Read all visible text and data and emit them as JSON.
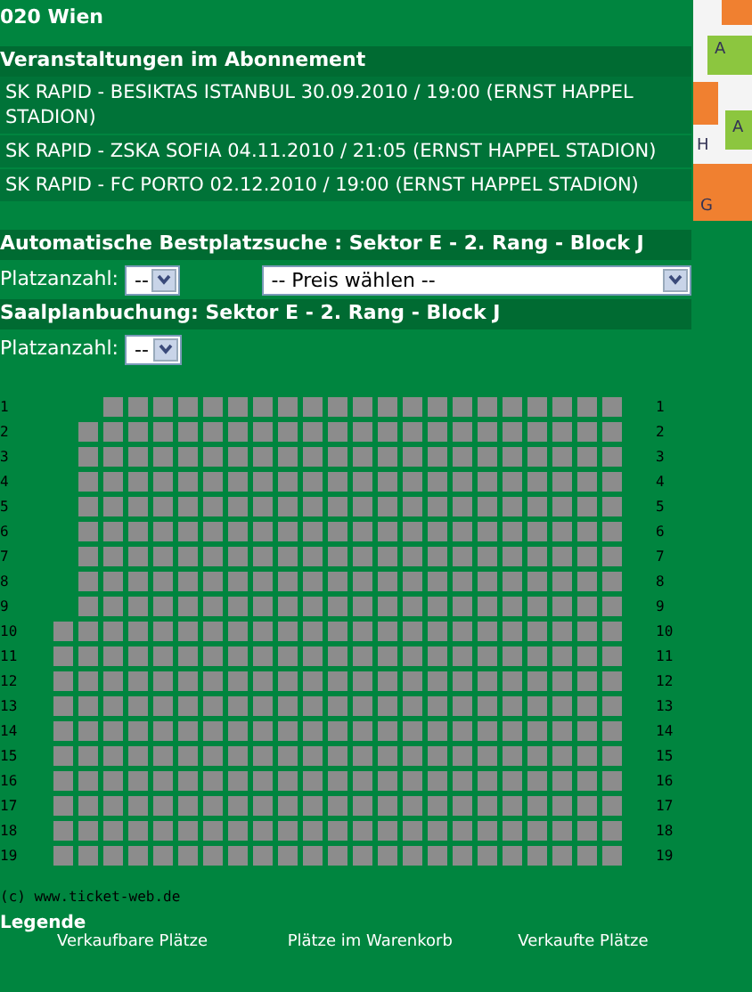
{
  "address": "020 Wien",
  "map": {
    "labels": [
      "A",
      "A",
      "H",
      "G"
    ]
  },
  "subscription": {
    "title": "Veranstaltungen im Abonnement",
    "events": [
      "SK RAPID - BESIKTAS ISTANBUL 30.09.2010 / 19:00 (ERNST HAPPEL STADION)",
      "SK RAPID - ZSKA SOFIA 04.11.2010 / 21:05 (ERNST HAPPEL STADION)",
      "SK RAPID - FC PORTO 02.12.2010 / 19:00 (ERNST HAPPEL STADION)"
    ]
  },
  "best_seat": {
    "title": "Automatische Bestplatzsuche : Sektor E - 2. Rang - Block J",
    "count_label": "Platzanzahl:",
    "count_value": "--",
    "price_value": "-- Preis wählen --"
  },
  "seat_plan": {
    "title": "Saalplanbuchung: Sektor E - 2. Rang - Block J",
    "count_label": "Platzanzahl:",
    "count_value": "--",
    "rows": [
      {
        "left_label": "1",
        "right_label": "1",
        "seats": [
          {
            "kind": "gap"
          },
          {
            "kind": "gap"
          },
          {
            "kind": "free"
          },
          {
            "kind": "free"
          },
          {
            "kind": "free"
          },
          {
            "kind": "free"
          },
          {
            "kind": "free"
          },
          {
            "kind": "free"
          },
          {
            "kind": "free"
          },
          {
            "kind": "free"
          },
          {
            "kind": "free"
          },
          {
            "kind": "free"
          },
          {
            "kind": "free"
          },
          {
            "kind": "free"
          },
          {
            "kind": "free"
          },
          {
            "kind": "free"
          },
          {
            "kind": "free"
          },
          {
            "kind": "free"
          },
          {
            "kind": "free"
          },
          {
            "kind": "free"
          },
          {
            "kind": "free"
          },
          {
            "kind": "free"
          },
          {
            "kind": "free"
          }
        ]
      },
      {
        "left_label": "2",
        "right_label": "2",
        "seats": [
          {
            "kind": "gap"
          },
          {
            "kind": "free"
          },
          {
            "kind": "free"
          },
          {
            "kind": "free"
          },
          {
            "kind": "free"
          },
          {
            "kind": "free"
          },
          {
            "kind": "free"
          },
          {
            "kind": "free"
          },
          {
            "kind": "free"
          },
          {
            "kind": "free"
          },
          {
            "kind": "free"
          },
          {
            "kind": "free"
          },
          {
            "kind": "free"
          },
          {
            "kind": "free"
          },
          {
            "kind": "free"
          },
          {
            "kind": "free"
          },
          {
            "kind": "free"
          },
          {
            "kind": "free"
          },
          {
            "kind": "free"
          },
          {
            "kind": "free"
          },
          {
            "kind": "free"
          },
          {
            "kind": "free"
          },
          {
            "kind": "free"
          }
        ]
      },
      {
        "left_label": "3",
        "right_label": "3",
        "seats": [
          {
            "kind": "gap"
          },
          {
            "kind": "free"
          },
          {
            "kind": "free"
          },
          {
            "kind": "free"
          },
          {
            "kind": "free"
          },
          {
            "kind": "free"
          },
          {
            "kind": "free"
          },
          {
            "kind": "free"
          },
          {
            "kind": "free"
          },
          {
            "kind": "free"
          },
          {
            "kind": "free"
          },
          {
            "kind": "free"
          },
          {
            "kind": "free"
          },
          {
            "kind": "free"
          },
          {
            "kind": "free"
          },
          {
            "kind": "free"
          },
          {
            "kind": "free"
          },
          {
            "kind": "free"
          },
          {
            "kind": "free"
          },
          {
            "kind": "free"
          },
          {
            "kind": "free"
          },
          {
            "kind": "free"
          },
          {
            "kind": "free"
          }
        ]
      },
      {
        "left_label": "4",
        "right_label": "4",
        "seats": [
          {
            "kind": "gap"
          },
          {
            "kind": "free"
          },
          {
            "kind": "free"
          },
          {
            "kind": "free"
          },
          {
            "kind": "free"
          },
          {
            "kind": "free"
          },
          {
            "kind": "free"
          },
          {
            "kind": "free"
          },
          {
            "kind": "free"
          },
          {
            "kind": "free"
          },
          {
            "kind": "free"
          },
          {
            "kind": "free"
          },
          {
            "kind": "free"
          },
          {
            "kind": "free"
          },
          {
            "kind": "free"
          },
          {
            "kind": "free"
          },
          {
            "kind": "free"
          },
          {
            "kind": "free"
          },
          {
            "kind": "free"
          },
          {
            "kind": "free"
          },
          {
            "kind": "free"
          },
          {
            "kind": "free"
          },
          {
            "kind": "free"
          }
        ]
      },
      {
        "left_label": "5",
        "right_label": "5",
        "seats": [
          {
            "kind": "gap"
          },
          {
            "kind": "free"
          },
          {
            "kind": "free"
          },
          {
            "kind": "free"
          },
          {
            "kind": "free"
          },
          {
            "kind": "free"
          },
          {
            "kind": "free"
          },
          {
            "kind": "free"
          },
          {
            "kind": "free"
          },
          {
            "kind": "free"
          },
          {
            "kind": "free"
          },
          {
            "kind": "free"
          },
          {
            "kind": "free"
          },
          {
            "kind": "free"
          },
          {
            "kind": "free"
          },
          {
            "kind": "free"
          },
          {
            "kind": "free"
          },
          {
            "kind": "free"
          },
          {
            "kind": "free"
          },
          {
            "kind": "free"
          },
          {
            "kind": "free"
          },
          {
            "kind": "free"
          },
          {
            "kind": "free"
          }
        ]
      },
      {
        "left_label": "6",
        "right_label": "6",
        "seats": [
          {
            "kind": "gap"
          },
          {
            "kind": "free"
          },
          {
            "kind": "free"
          },
          {
            "kind": "free"
          },
          {
            "kind": "free"
          },
          {
            "kind": "free"
          },
          {
            "kind": "free"
          },
          {
            "kind": "free"
          },
          {
            "kind": "free"
          },
          {
            "kind": "free"
          },
          {
            "kind": "free"
          },
          {
            "kind": "free"
          },
          {
            "kind": "free"
          },
          {
            "kind": "free"
          },
          {
            "kind": "free"
          },
          {
            "kind": "free"
          },
          {
            "kind": "free"
          },
          {
            "kind": "free"
          },
          {
            "kind": "free"
          },
          {
            "kind": "free"
          },
          {
            "kind": "free"
          },
          {
            "kind": "free"
          },
          {
            "kind": "free"
          }
        ]
      },
      {
        "left_label": "7",
        "right_label": "7",
        "seats": [
          {
            "kind": "gap"
          },
          {
            "kind": "free"
          },
          {
            "kind": "free"
          },
          {
            "kind": "free"
          },
          {
            "kind": "free"
          },
          {
            "kind": "free"
          },
          {
            "kind": "free"
          },
          {
            "kind": "free"
          },
          {
            "kind": "free"
          },
          {
            "kind": "free"
          },
          {
            "kind": "free"
          },
          {
            "kind": "free"
          },
          {
            "kind": "free"
          },
          {
            "kind": "free"
          },
          {
            "kind": "free"
          },
          {
            "kind": "free"
          },
          {
            "kind": "free"
          },
          {
            "kind": "free"
          },
          {
            "kind": "free"
          },
          {
            "kind": "free"
          },
          {
            "kind": "free"
          },
          {
            "kind": "free"
          },
          {
            "kind": "free"
          }
        ]
      },
      {
        "left_label": "8",
        "right_label": "8",
        "seats": [
          {
            "kind": "gap"
          },
          {
            "kind": "free"
          },
          {
            "kind": "free"
          },
          {
            "kind": "free"
          },
          {
            "kind": "free"
          },
          {
            "kind": "free"
          },
          {
            "kind": "free"
          },
          {
            "kind": "free"
          },
          {
            "kind": "free"
          },
          {
            "kind": "free"
          },
          {
            "kind": "free"
          },
          {
            "kind": "free"
          },
          {
            "kind": "free"
          },
          {
            "kind": "free"
          },
          {
            "kind": "free"
          },
          {
            "kind": "free"
          },
          {
            "kind": "free"
          },
          {
            "kind": "free"
          },
          {
            "kind": "free"
          },
          {
            "kind": "free"
          },
          {
            "kind": "free"
          },
          {
            "kind": "free"
          },
          {
            "kind": "free"
          }
        ]
      },
      {
        "left_label": "9",
        "right_label": "9",
        "seats": [
          {
            "kind": "gap"
          },
          {
            "kind": "free"
          },
          {
            "kind": "free"
          },
          {
            "kind": "free"
          },
          {
            "kind": "free"
          },
          {
            "kind": "free"
          },
          {
            "kind": "free"
          },
          {
            "kind": "free"
          },
          {
            "kind": "free"
          },
          {
            "kind": "free"
          },
          {
            "kind": "free"
          },
          {
            "kind": "free"
          },
          {
            "kind": "free"
          },
          {
            "kind": "free"
          },
          {
            "kind": "free"
          },
          {
            "kind": "free"
          },
          {
            "kind": "free"
          },
          {
            "kind": "free"
          },
          {
            "kind": "free"
          },
          {
            "kind": "free"
          },
          {
            "kind": "free"
          },
          {
            "kind": "free"
          },
          {
            "kind": "free"
          }
        ]
      },
      {
        "left_label": "10",
        "right_label": "10",
        "seats": [
          {
            "kind": "free"
          },
          {
            "kind": "free"
          },
          {
            "kind": "free"
          },
          {
            "kind": "free"
          },
          {
            "kind": "free"
          },
          {
            "kind": "free"
          },
          {
            "kind": "free"
          },
          {
            "kind": "free"
          },
          {
            "kind": "free"
          },
          {
            "kind": "free"
          },
          {
            "kind": "free"
          },
          {
            "kind": "free"
          },
          {
            "kind": "free"
          },
          {
            "kind": "free"
          },
          {
            "kind": "free"
          },
          {
            "kind": "free"
          },
          {
            "kind": "free"
          },
          {
            "kind": "free"
          },
          {
            "kind": "free"
          },
          {
            "kind": "free"
          },
          {
            "kind": "free"
          },
          {
            "kind": "free"
          },
          {
            "kind": "free"
          }
        ]
      },
      {
        "left_label": "11",
        "right_label": "11",
        "seats": [
          {
            "kind": "free"
          },
          {
            "kind": "free"
          },
          {
            "kind": "free"
          },
          {
            "kind": "free"
          },
          {
            "kind": "free"
          },
          {
            "kind": "free"
          },
          {
            "kind": "free"
          },
          {
            "kind": "free"
          },
          {
            "kind": "free"
          },
          {
            "kind": "free"
          },
          {
            "kind": "free"
          },
          {
            "kind": "free"
          },
          {
            "kind": "free"
          },
          {
            "kind": "free"
          },
          {
            "kind": "free"
          },
          {
            "kind": "free"
          },
          {
            "kind": "free"
          },
          {
            "kind": "free"
          },
          {
            "kind": "free"
          },
          {
            "kind": "free"
          },
          {
            "kind": "free"
          },
          {
            "kind": "free"
          },
          {
            "kind": "free"
          }
        ]
      },
      {
        "left_label": "12",
        "right_label": "12",
        "seats": [
          {
            "kind": "free"
          },
          {
            "kind": "free"
          },
          {
            "kind": "free"
          },
          {
            "kind": "free"
          },
          {
            "kind": "free"
          },
          {
            "kind": "free"
          },
          {
            "kind": "free"
          },
          {
            "kind": "free"
          },
          {
            "kind": "free"
          },
          {
            "kind": "free"
          },
          {
            "kind": "free"
          },
          {
            "kind": "free"
          },
          {
            "kind": "free"
          },
          {
            "kind": "free"
          },
          {
            "kind": "free"
          },
          {
            "kind": "free"
          },
          {
            "kind": "free"
          },
          {
            "kind": "free"
          },
          {
            "kind": "free"
          },
          {
            "kind": "free"
          },
          {
            "kind": "free"
          },
          {
            "kind": "free"
          },
          {
            "kind": "free"
          }
        ]
      },
      {
        "left_label": "13",
        "right_label": "13",
        "seats": [
          {
            "kind": "free"
          },
          {
            "kind": "free"
          },
          {
            "kind": "free"
          },
          {
            "kind": "free"
          },
          {
            "kind": "free"
          },
          {
            "kind": "free"
          },
          {
            "kind": "free"
          },
          {
            "kind": "free"
          },
          {
            "kind": "free"
          },
          {
            "kind": "free"
          },
          {
            "kind": "free"
          },
          {
            "kind": "free"
          },
          {
            "kind": "free"
          },
          {
            "kind": "free"
          },
          {
            "kind": "free"
          },
          {
            "kind": "free"
          },
          {
            "kind": "free"
          },
          {
            "kind": "free"
          },
          {
            "kind": "free"
          },
          {
            "kind": "free"
          },
          {
            "kind": "free"
          },
          {
            "kind": "free"
          },
          {
            "kind": "free"
          }
        ]
      },
      {
        "left_label": "14",
        "right_label": "14",
        "seats": [
          {
            "kind": "free"
          },
          {
            "kind": "free"
          },
          {
            "kind": "free"
          },
          {
            "kind": "free"
          },
          {
            "kind": "free"
          },
          {
            "kind": "free"
          },
          {
            "kind": "free"
          },
          {
            "kind": "free"
          },
          {
            "kind": "free"
          },
          {
            "kind": "free"
          },
          {
            "kind": "free"
          },
          {
            "kind": "free"
          },
          {
            "kind": "free"
          },
          {
            "kind": "free"
          },
          {
            "kind": "free"
          },
          {
            "kind": "free"
          },
          {
            "kind": "free"
          },
          {
            "kind": "free"
          },
          {
            "kind": "free"
          },
          {
            "kind": "free"
          },
          {
            "kind": "free"
          },
          {
            "kind": "free"
          },
          {
            "kind": "free"
          }
        ]
      },
      {
        "left_label": "15",
        "right_label": "15",
        "seats": [
          {
            "kind": "free"
          },
          {
            "kind": "free"
          },
          {
            "kind": "free"
          },
          {
            "kind": "free"
          },
          {
            "kind": "free"
          },
          {
            "kind": "free"
          },
          {
            "kind": "free"
          },
          {
            "kind": "free"
          },
          {
            "kind": "free"
          },
          {
            "kind": "free"
          },
          {
            "kind": "free"
          },
          {
            "kind": "free"
          },
          {
            "kind": "free"
          },
          {
            "kind": "free"
          },
          {
            "kind": "free"
          },
          {
            "kind": "free"
          },
          {
            "kind": "free"
          },
          {
            "kind": "free"
          },
          {
            "kind": "free"
          },
          {
            "kind": "free"
          },
          {
            "kind": "free"
          },
          {
            "kind": "free"
          },
          {
            "kind": "free"
          }
        ]
      },
      {
        "left_label": "16",
        "right_label": "16",
        "seats": [
          {
            "kind": "free"
          },
          {
            "kind": "free"
          },
          {
            "kind": "free"
          },
          {
            "kind": "free"
          },
          {
            "kind": "free"
          },
          {
            "kind": "free"
          },
          {
            "kind": "free"
          },
          {
            "kind": "free"
          },
          {
            "kind": "free"
          },
          {
            "kind": "free"
          },
          {
            "kind": "free"
          },
          {
            "kind": "free"
          },
          {
            "kind": "free"
          },
          {
            "kind": "free"
          },
          {
            "kind": "free"
          },
          {
            "kind": "free"
          },
          {
            "kind": "free"
          },
          {
            "kind": "free"
          },
          {
            "kind": "free"
          },
          {
            "kind": "free"
          },
          {
            "kind": "free"
          },
          {
            "kind": "free"
          },
          {
            "kind": "free"
          }
        ]
      },
      {
        "left_label": "17",
        "right_label": "17",
        "seats": [
          {
            "kind": "free"
          },
          {
            "kind": "free"
          },
          {
            "kind": "free"
          },
          {
            "kind": "free"
          },
          {
            "kind": "free"
          },
          {
            "kind": "free"
          },
          {
            "kind": "free"
          },
          {
            "kind": "free"
          },
          {
            "kind": "free"
          },
          {
            "kind": "free"
          },
          {
            "kind": "free"
          },
          {
            "kind": "free"
          },
          {
            "kind": "free"
          },
          {
            "kind": "free"
          },
          {
            "kind": "free"
          },
          {
            "kind": "free"
          },
          {
            "kind": "free"
          },
          {
            "kind": "free"
          },
          {
            "kind": "free"
          },
          {
            "kind": "free"
          },
          {
            "kind": "free"
          },
          {
            "kind": "free"
          },
          {
            "kind": "free"
          }
        ]
      },
      {
        "left_label": "18",
        "right_label": "18",
        "seats": [
          {
            "kind": "free"
          },
          {
            "kind": "free"
          },
          {
            "kind": "free"
          },
          {
            "kind": "free"
          },
          {
            "kind": "free"
          },
          {
            "kind": "free"
          },
          {
            "kind": "free"
          },
          {
            "kind": "free"
          },
          {
            "kind": "free"
          },
          {
            "kind": "free"
          },
          {
            "kind": "free"
          },
          {
            "kind": "free"
          },
          {
            "kind": "free"
          },
          {
            "kind": "free"
          },
          {
            "kind": "free"
          },
          {
            "kind": "free"
          },
          {
            "kind": "free"
          },
          {
            "kind": "free"
          },
          {
            "kind": "free"
          },
          {
            "kind": "free"
          },
          {
            "kind": "free"
          },
          {
            "kind": "free"
          },
          {
            "kind": "free"
          }
        ]
      },
      {
        "left_label": "19",
        "right_label": "19",
        "seats": [
          {
            "kind": "free"
          },
          {
            "kind": "free"
          },
          {
            "kind": "free"
          },
          {
            "kind": "free"
          },
          {
            "kind": "free"
          },
          {
            "kind": "free"
          },
          {
            "kind": "free"
          },
          {
            "kind": "free"
          },
          {
            "kind": "free"
          },
          {
            "kind": "free"
          },
          {
            "kind": "free"
          },
          {
            "kind": "free"
          },
          {
            "kind": "free"
          },
          {
            "kind": "free"
          },
          {
            "kind": "free"
          },
          {
            "kind": "free"
          },
          {
            "kind": "free"
          },
          {
            "kind": "free"
          },
          {
            "kind": "free"
          },
          {
            "kind": "free"
          },
          {
            "kind": "free"
          },
          {
            "kind": "free"
          },
          {
            "kind": "free"
          }
        ]
      }
    ]
  },
  "copyright": "(c) www.ticket-web.de",
  "legend": {
    "title": "Legende",
    "items": [
      "Verkaufbare Plätze",
      "Plätze im Warenkorb",
      "Verkaufte Plätze"
    ]
  }
}
